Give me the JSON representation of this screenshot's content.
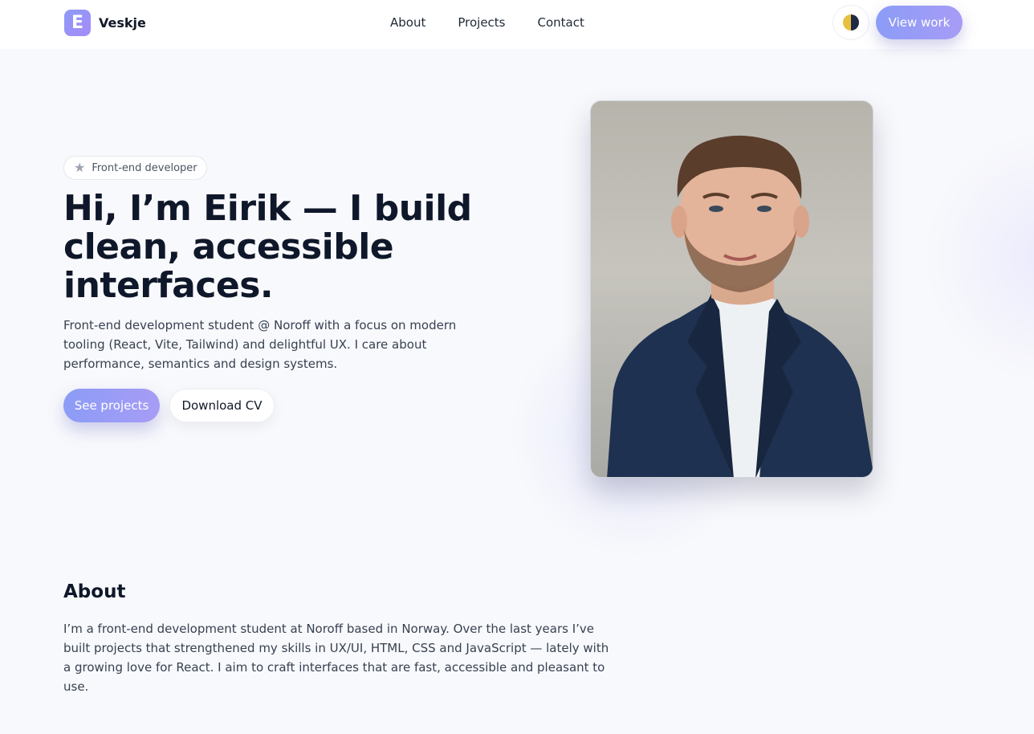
{
  "header": {
    "logo_letter": "E",
    "brand": "Veskje",
    "nav": [
      "About",
      "Projects",
      "Contact"
    ],
    "view_work_label": "View work"
  },
  "hero": {
    "badge": "Front-end developer",
    "title": "Hi, I’m Eirik — I build clean, accessible interfaces.",
    "subtitle": "Front-end development student @ Noroff with a focus on modern tooling (React, Vite, Tailwind) and delightful UX. I care about performance, semantics and design systems.",
    "primary_button": "See projects",
    "secondary_button": "Download CV"
  },
  "about": {
    "title": "About",
    "text": "I’m a front-end development student at Noroff based in Norway. Over the last years I’ve built projects that strengthened my skills in UX/UI, HTML, CSS and JavaScript — lately with a growing love for React. I aim to craft interfaces that are fast, accessible and pleasant to use."
  },
  "icons": {
    "theme_toggle": "half-moon-icon",
    "badge": "star-icon"
  },
  "colors": {
    "accent_start": "#8b9cf7",
    "accent_end": "#a79cf5",
    "heading": "#0f172a",
    "body_text": "#374151",
    "background": "#f8f9fc"
  }
}
